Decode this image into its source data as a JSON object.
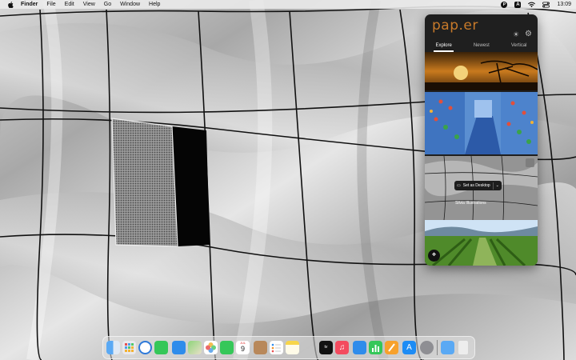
{
  "menubar": {
    "items": [
      "Finder",
      "File",
      "Edit",
      "View",
      "Go",
      "Window",
      "Help"
    ],
    "status": {
      "paper_icon_letter": "P",
      "input_icon_letter": "A",
      "clock": "13:09"
    }
  },
  "paper_app": {
    "brand": "pap.er",
    "tabs": [
      "Explore",
      "Newest",
      "Vertical"
    ],
    "active_tab": "Explore",
    "set_desktop_label": "Set as Desktop",
    "credit_text": "Silvia Illustrations",
    "accent_color": "#c87a2a"
  },
  "dock": {
    "apps": [
      "Finder",
      "Launchpad",
      "Safari",
      "Messages",
      "Mail",
      "Maps",
      "Photos",
      "FaceTime",
      "Calendar",
      "Contacts",
      "Reminders",
      "Notes",
      "Apple TV",
      "Music",
      "Keynote",
      "Numbers",
      "Pages",
      "App Store",
      "System Preferences",
      "Downloads",
      "Trash"
    ],
    "calendar_month": "JUL",
    "calendar_day": "9"
  }
}
